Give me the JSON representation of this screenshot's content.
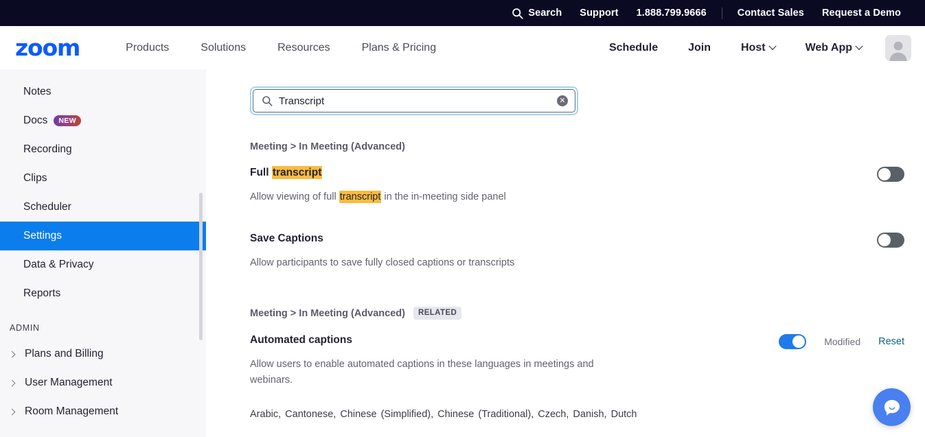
{
  "topbar": {
    "search": "Search",
    "search_icon": "magnifier-icon",
    "support": "Support",
    "phone": "1.888.799.9666",
    "contact_sales": "Contact Sales",
    "request_demo": "Request a Demo"
  },
  "nav": {
    "logo": "zoom",
    "items": [
      {
        "label": "Products"
      },
      {
        "label": "Solutions"
      },
      {
        "label": "Resources"
      },
      {
        "label": "Plans & Pricing"
      }
    ],
    "actions": [
      {
        "label": "Schedule",
        "chevron": false
      },
      {
        "label": "Join",
        "chevron": false
      },
      {
        "label": "Host",
        "chevron": true
      },
      {
        "label": "Web App",
        "chevron": true
      }
    ],
    "avatar": "user-avatar"
  },
  "sidebar": {
    "items": [
      {
        "label": "Notes",
        "active": false,
        "badge": null
      },
      {
        "label": "Docs",
        "active": false,
        "badge": "NEW"
      },
      {
        "label": "Recording",
        "active": false,
        "badge": null
      },
      {
        "label": "Clips",
        "active": false,
        "badge": null
      },
      {
        "label": "Scheduler",
        "active": false,
        "badge": null
      },
      {
        "label": "Settings",
        "active": true,
        "badge": null
      },
      {
        "label": "Data & Privacy",
        "active": false,
        "badge": null
      },
      {
        "label": "Reports",
        "active": false,
        "badge": null
      }
    ],
    "admin_label": "ADMIN",
    "admin_items": [
      {
        "label": "Plans and Billing"
      },
      {
        "label": "User Management"
      },
      {
        "label": "Room Management"
      }
    ]
  },
  "search": {
    "value": "Transcript",
    "placeholder": "Search",
    "icon": "search-icon",
    "clear_icon": "clear-circle-icon",
    "clear_glyph": "✕"
  },
  "results": {
    "groups": [
      {
        "breadcrumb": "Meeting > In Meeting (Advanced)",
        "related_badge": null,
        "settings": [
          {
            "title_prefix": "Full ",
            "title_highlight": "transcript",
            "title_suffix": "",
            "desc_prefix": "Allow viewing of full ",
            "desc_highlight": "transcript",
            "desc_suffix": " in the in-meeting side panel",
            "toggle_on": false,
            "modified": null,
            "reset": null,
            "languages": null
          },
          {
            "title_prefix": "Save Captions",
            "title_highlight": "",
            "title_suffix": "",
            "desc_prefix": "Allow participants to save fully closed captions or transcripts",
            "desc_highlight": "",
            "desc_suffix": "",
            "toggle_on": false,
            "modified": null,
            "reset": null,
            "languages": null
          }
        ]
      },
      {
        "breadcrumb": "Meeting > In Meeting (Advanced)",
        "related_badge": "RELATED",
        "settings": [
          {
            "title_prefix": "Automated captions",
            "title_highlight": "",
            "title_suffix": "",
            "desc_prefix": "Allow users to enable automated captions in these languages in meetings and webinars.",
            "desc_highlight": "",
            "desc_suffix": "",
            "toggle_on": true,
            "modified": "Modified",
            "reset": "Reset",
            "languages": "Arabic,  Cantonese,  Chinese (Simplified),  Chinese (Traditional),  Czech,  Danish,  Dutch"
          }
        ]
      }
    ]
  },
  "chat_widget": {
    "icon": "chat-bubble-smile-icon"
  },
  "colors": {
    "topbar_bg": "#0a0a23",
    "brand_blue": "#0b5cff",
    "sidebar_active": "#0b7ded",
    "toggle_on": "#1e7ae8",
    "toggle_off": "#5a6068",
    "highlight": "#fbbb3c",
    "reset_link": "#16618b",
    "badge_related_bg": "#e6e6ee"
  }
}
